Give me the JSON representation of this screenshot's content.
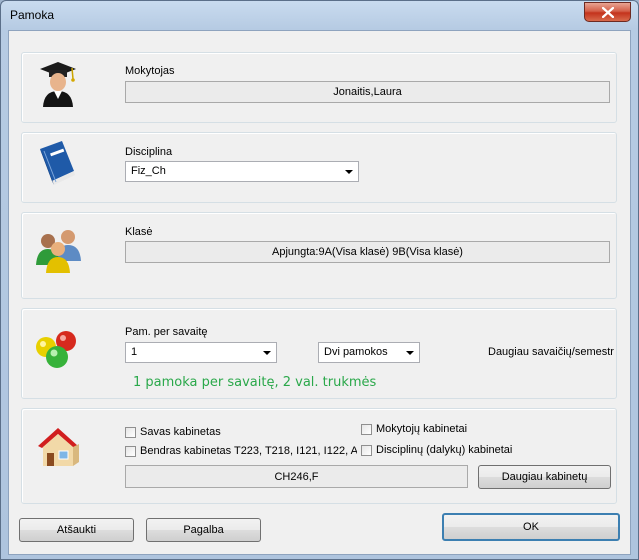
{
  "window": {
    "title": "Pamoka"
  },
  "teacher": {
    "label": "Mokytojas",
    "value": "Jonaitis,Laura"
  },
  "discipline": {
    "label": "Disciplina",
    "value": "Fiz_Ch"
  },
  "class": {
    "label": "Klasė",
    "value": "Apjungta:9A(Visa klasė) 9B(Visa klasė)"
  },
  "lessons": {
    "label": "Pam. per savaitę",
    "count_value": "1",
    "duration_value": "Dvi pamokos",
    "more_weeks_label": "Daugiau savaičių/semestr",
    "summary": "1 pamoka per savaitę, 2 val. trukmės"
  },
  "rooms": {
    "own_room": "Savas kabinetas",
    "teacher_rooms": "Mokytojų kabinetai",
    "shared_room": "Bendras kabinetas T223, T218, I121, I122, A",
    "discipline_rooms": "Disciplinų (dalykų) kabinetai",
    "value": "CH246,F",
    "more_button": "Daugiau kabinetų"
  },
  "footer": {
    "cancel": "Atšaukti",
    "help": "Pagalba",
    "ok": "OK"
  }
}
